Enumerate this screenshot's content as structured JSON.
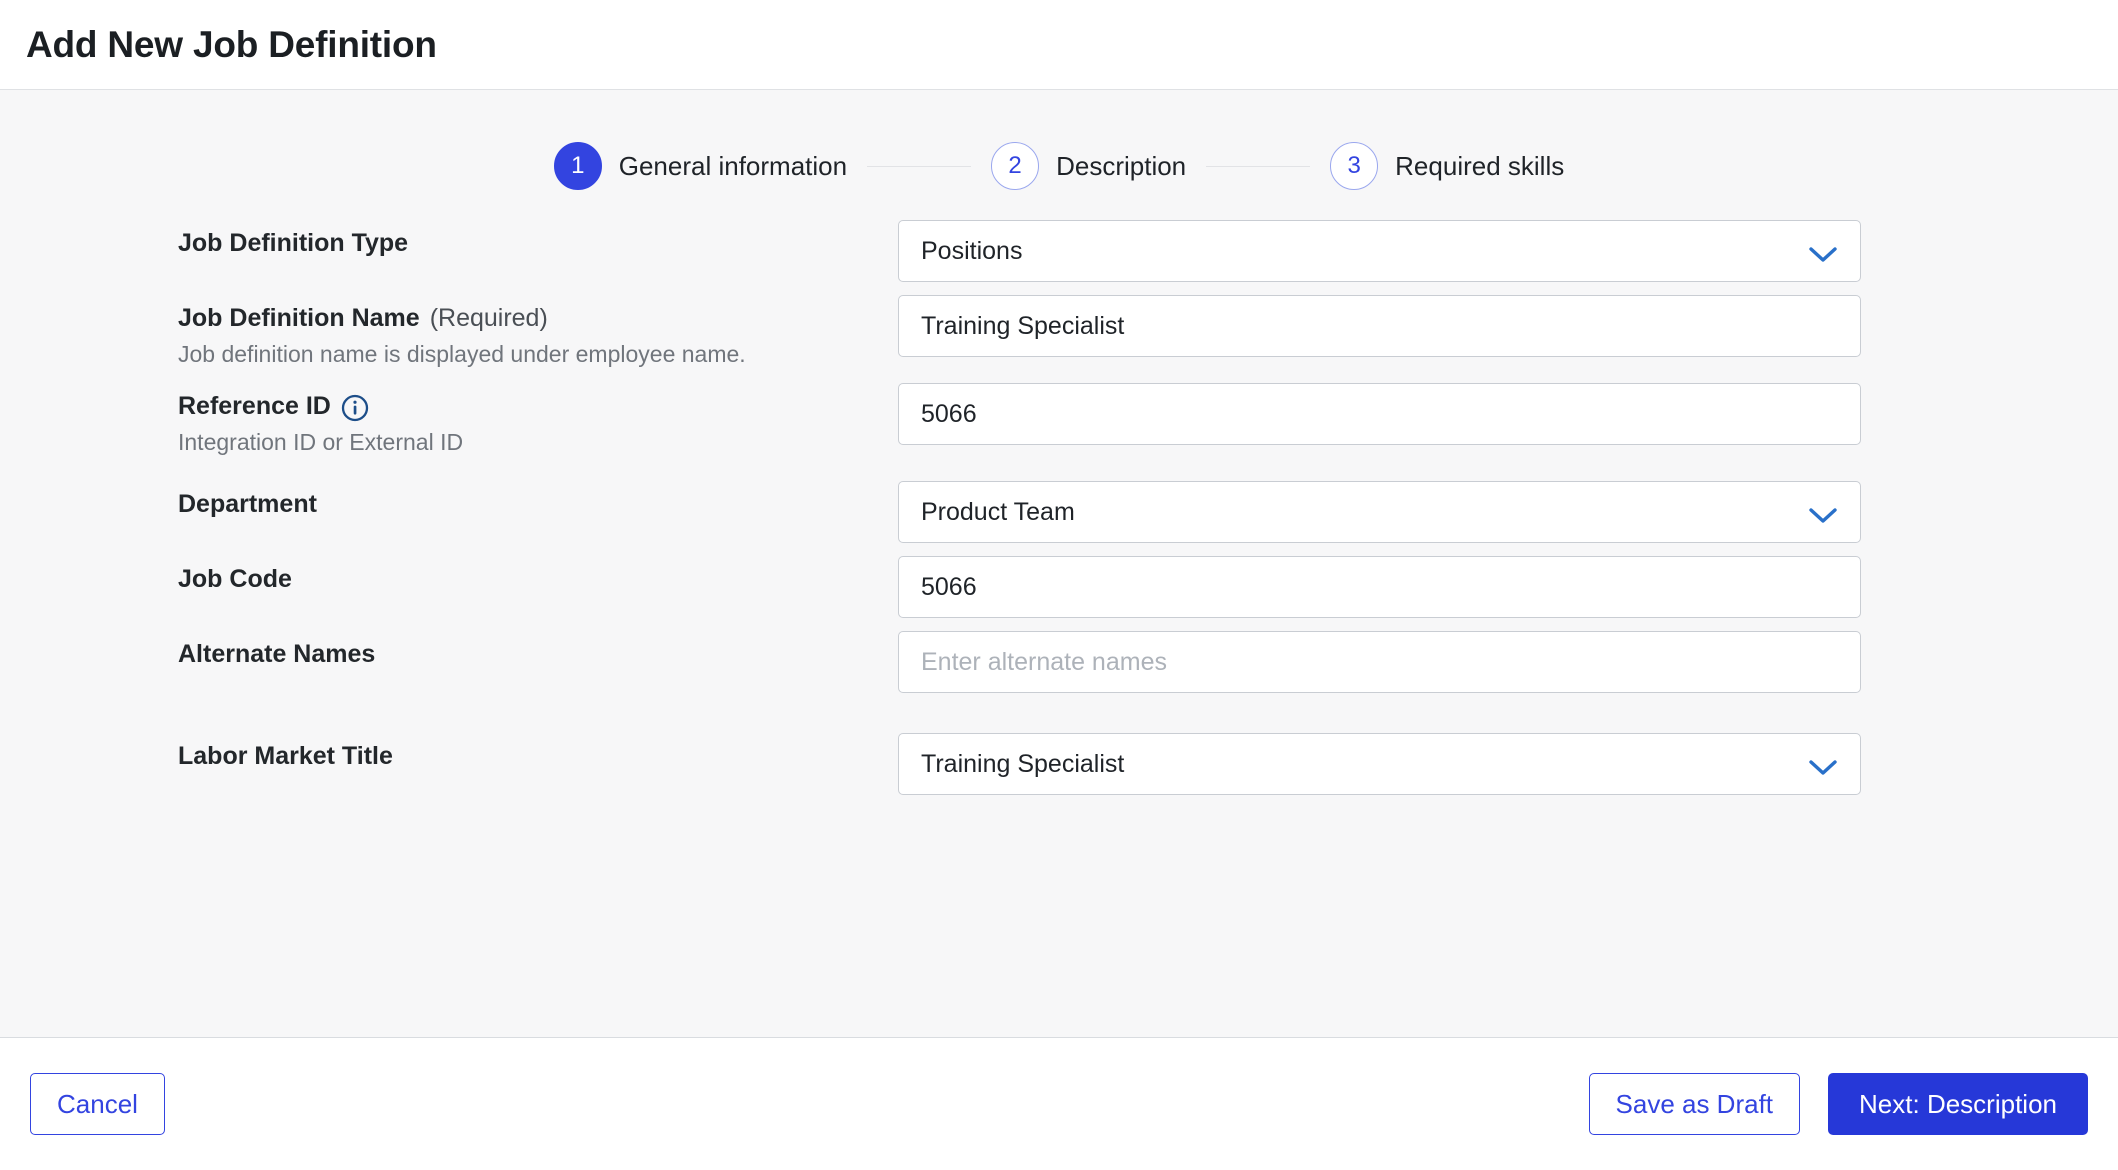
{
  "header": {
    "title": "Add New Job Definition"
  },
  "stepper": {
    "steps": [
      {
        "number": "1",
        "label": "General information",
        "state": "active"
      },
      {
        "number": "2",
        "label": "Description",
        "state": "inactive"
      },
      {
        "number": "3",
        "label": "Required skills",
        "state": "inactive"
      }
    ]
  },
  "form": {
    "fields": [
      {
        "label": "Job Definition Type",
        "suffix": "",
        "help": "",
        "info_icon": false,
        "control": "select",
        "value": "Positions",
        "placeholder": ""
      },
      {
        "label": "Job Definition Name",
        "suffix": "(Required)",
        "help": "Job definition name is displayed under employee name.",
        "info_icon": false,
        "control": "text",
        "value": "Training Specialist",
        "placeholder": ""
      },
      {
        "label": "Reference ID",
        "suffix": "",
        "help": "Integration ID or External ID",
        "info_icon": true,
        "control": "text",
        "value": "5066",
        "placeholder": ""
      },
      {
        "label": "Department",
        "suffix": "",
        "help": "",
        "info_icon": false,
        "control": "select",
        "value": "Product Team",
        "placeholder": ""
      },
      {
        "label": "Job Code",
        "suffix": "",
        "help": "",
        "info_icon": false,
        "control": "text",
        "value": "5066",
        "placeholder": ""
      },
      {
        "label": "Alternate Names",
        "suffix": "",
        "help": "",
        "info_icon": false,
        "control": "text",
        "value": "",
        "placeholder": "Enter alternate names"
      },
      {
        "label": "Labor Market Title",
        "suffix": "",
        "help": "",
        "info_icon": false,
        "control": "select",
        "value": "Training Specialist",
        "placeholder": ""
      }
    ]
  },
  "footer": {
    "cancel_label": "Cancel",
    "save_draft_label": "Save as Draft",
    "next_label": "Next: Description"
  },
  "colors": {
    "accent": "#3344e0",
    "primary_button": "#2638d8",
    "chevron": "#2970c9",
    "info_icon": "#1d4e89",
    "content_bg": "#f7f7f8",
    "border": "#c9cdd3"
  },
  "icons": {
    "info": "info-icon",
    "chevron_down": "chevron-down-icon"
  }
}
